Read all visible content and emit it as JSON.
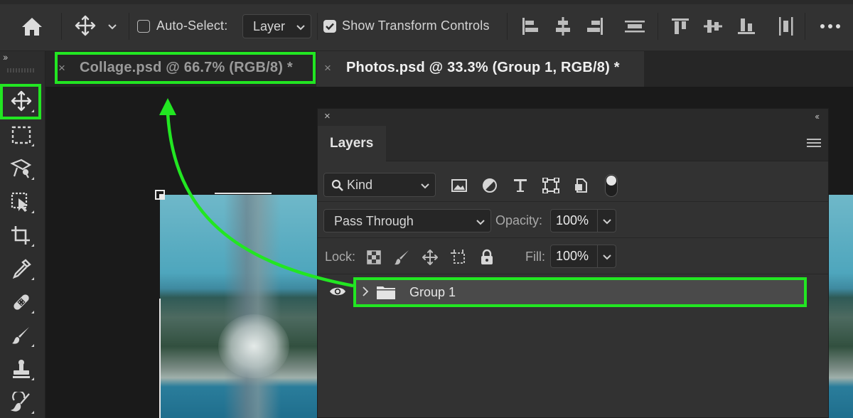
{
  "options_bar": {
    "auto_select_label": "Auto-Select:",
    "auto_select_checked": false,
    "auto_select_target": "Layer",
    "show_transform_label": "Show Transform Controls",
    "show_transform_checked": true,
    "icons": [
      "home-icon",
      "move-tool-icon",
      "chevron-down-icon",
      "align-left-icon",
      "align-horizontal-center-icon",
      "align-right-icon",
      "align-vertical-distribute-icon",
      "align-top-icon",
      "align-vertical-center-icon",
      "align-bottom-icon",
      "distribute-icon",
      "more-icon"
    ]
  },
  "toolbar": {
    "collapse_glyph": "››",
    "tools": [
      "move-tool-icon",
      "marquee-tool-icon",
      "lasso-tool-icon",
      "object-select-tool-icon",
      "crop-tool-icon",
      "eyedropper-tool-icon",
      "healing-brush-tool-icon",
      "brush-tool-icon",
      "clone-stamp-tool-icon",
      "history-brush-tool-icon"
    ]
  },
  "doc_tabs": [
    {
      "close": "×",
      "title": "Collage.psd @ 66.7% (RGB/8) *",
      "active": false
    },
    {
      "close": "×",
      "title": "Photos.psd @ 33.3% (Group 1, RGB/8) *",
      "active": true
    }
  ],
  "layers_panel": {
    "close_glyph": "×",
    "collapse_glyph": "‹‹",
    "tab_label": "Layers",
    "kind_label": "Kind",
    "filter_icons": [
      "image-filter-icon",
      "adjustment-filter-icon",
      "type-filter-icon",
      "shape-filter-icon",
      "smart-object-filter-icon"
    ],
    "blend_mode": "Pass Through",
    "opacity_label": "Opacity:",
    "opacity_value": "100%",
    "lock_label": "Lock:",
    "lock_icons": [
      "lock-transparent-icon",
      "lock-image-icon",
      "lock-position-icon",
      "lock-artboard-icon",
      "lock-all-icon"
    ],
    "fill_label": "Fill:",
    "fill_value": "100%",
    "layers": [
      {
        "name": "Group 1",
        "type": "group",
        "visible": true,
        "selected": true
      }
    ]
  },
  "annotation": {
    "highlight_color": "#22e622"
  }
}
